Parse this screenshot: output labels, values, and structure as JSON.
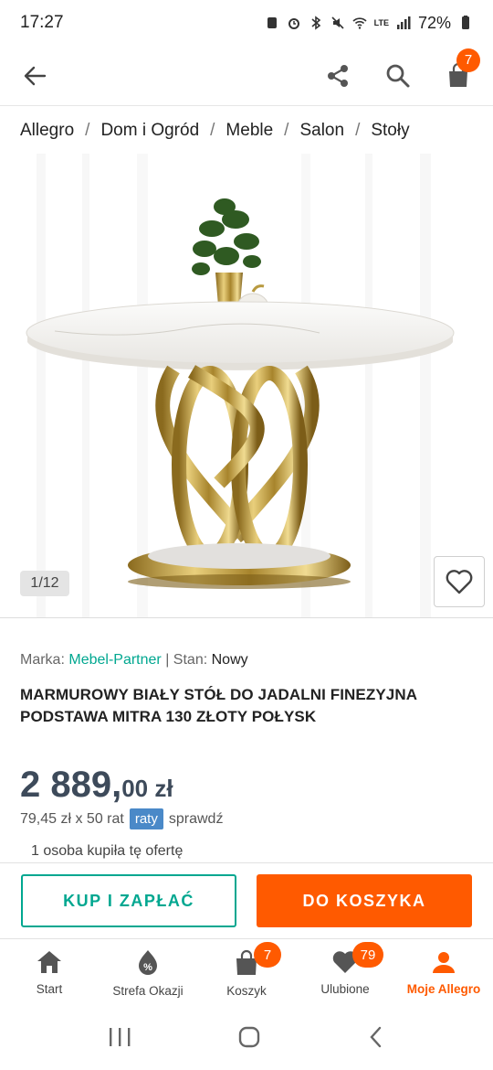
{
  "status_bar": {
    "time": "17:27",
    "battery": "72%",
    "network": "LTE"
  },
  "toolbar": {
    "cart_count": "7"
  },
  "breadcrumb": [
    "Allegro",
    "Dom i Ogród",
    "Meble",
    "Salon",
    "Stoły"
  ],
  "breadcrumb_separator": "/",
  "gallery": {
    "counter": "1/12"
  },
  "product": {
    "brand_label": "Marka:",
    "brand": "Mebel-Partner",
    "divider": "|",
    "condition_label": "Stan:",
    "condition": "Nowy",
    "title": "MARMUROWY BIAŁY STÓŁ DO JADALNI FINEZYJNA PODSTAWA MITRA 130 ZŁOTY POŁYSK",
    "price_main": "2 889,",
    "price_decimals": "00 zł",
    "installments": "79,45 zł x 50 rat",
    "raty_badge": "raty",
    "check_link": "sprawdź",
    "bought_info": "1 osoba kupiła tę ofertę"
  },
  "actions": {
    "buy_now": "KUP I ZAPŁAĆ",
    "add_to_cart": "DO KOSZYKA"
  },
  "bottom_nav": [
    {
      "label": "Start",
      "icon": "home-icon"
    },
    {
      "label": "Strefa Okazji",
      "icon": "deals-icon"
    },
    {
      "label": "Koszyk",
      "icon": "bag-icon",
      "badge": "7"
    },
    {
      "label": "Ulubione",
      "icon": "heart-icon",
      "badge": "79"
    },
    {
      "label": "Moje Allegro",
      "icon": "user-icon",
      "active": true
    }
  ],
  "colors": {
    "accent": "#ff5a00",
    "teal": "#00a790",
    "price": "#3d4a5a",
    "raty": "#4a89c8"
  }
}
